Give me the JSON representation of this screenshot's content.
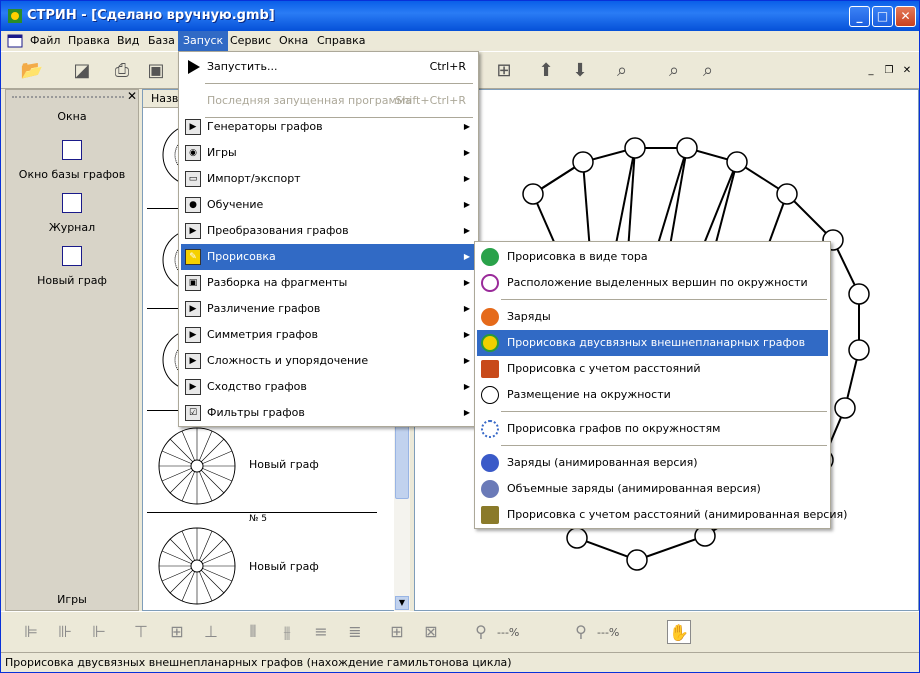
{
  "window": {
    "title": "СТРИН - [Сделано вручную.gmb]"
  },
  "menubar": [
    "Файл",
    "Правка",
    "Вид",
    "База",
    "Запуск",
    "Сервис",
    "Окна",
    "Справка"
  ],
  "left_panel": {
    "section_title": "Окна",
    "items": [
      "Окно базы графов",
      "Журнал",
      "Новый граф"
    ],
    "bottom_label": "Игры"
  },
  "list_panel": {
    "column_header": "Назва",
    "items": [
      {
        "name": "Новый граф"
      },
      {
        "label": "№ 5"
      },
      {
        "name": "Новый граф"
      }
    ]
  },
  "run_menu": {
    "items": [
      {
        "label": "Запустить...",
        "shortcut": "Ctrl+R",
        "enabled": true
      },
      {
        "label": "Последняя запущенная программа",
        "shortcut": "Shift+Ctrl+R",
        "enabled": false
      },
      {
        "label": "Генераторы графов"
      },
      {
        "label": "Игры"
      },
      {
        "label": "Импорт/экспорт"
      },
      {
        "label": "Обучение"
      },
      {
        "label": "Преобразования графов"
      },
      {
        "label": "Прорисовка",
        "highlighted": true
      },
      {
        "label": "Разборка на фрагменты"
      },
      {
        "label": "Различение графов"
      },
      {
        "label": "Симметрия графов"
      },
      {
        "label": "Сложность и упорядочение"
      },
      {
        "label": "Сходство графов"
      },
      {
        "label": "Фильтры графов"
      }
    ]
  },
  "draw_submenu": {
    "items": [
      {
        "label": "Прорисовка в виде тора"
      },
      {
        "label": "Расположение выделенных вершин по окружности"
      },
      {
        "label": "Заряды"
      },
      {
        "label": "Прорисовка двусвязных внешнепланарных графов",
        "highlighted": true
      },
      {
        "label": "Прорисовка с учетом расстояний"
      },
      {
        "label": "Размещение на окружности"
      },
      {
        "label": "Прорисовка графов по окружностям"
      },
      {
        "label": "Заряды (анимированная версия)"
      },
      {
        "label": "Объемные заряды (анимированная версия)"
      },
      {
        "label": "Прорисовка с учетом расстояний (анимированная версия)"
      }
    ]
  },
  "zoom": {
    "left": "---%",
    "right": "---%"
  },
  "status_bar": "Прорисовка двусвязных внешнепланарных графов (нахождение гамильтонова цикла)",
  "colors": {
    "highlight": "#316AC5",
    "titlebar": "#0A5FE8",
    "chrome": "#ECE9D8"
  }
}
